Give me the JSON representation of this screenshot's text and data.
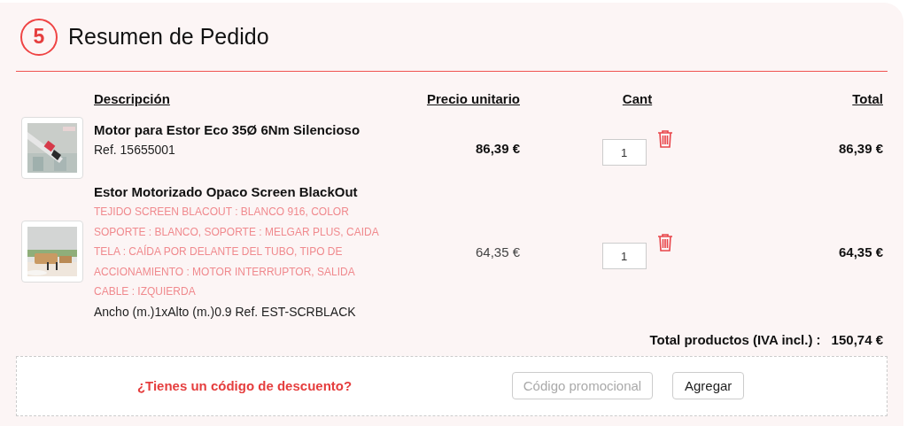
{
  "header": {
    "step": "5",
    "title": "Resumen de Pedido"
  },
  "table": {
    "columns": [
      "Descripción",
      "Precio unitario",
      "Cant",
      "Total"
    ],
    "rows": [
      {
        "name": "Motor para Estor Eco 35Ø 6Nm Silencioso",
        "options": "",
        "ref": "Ref. 15655001",
        "unit_price": "86,39 €",
        "price_emphasized": true,
        "quantity": "1",
        "total": "86,39 €"
      },
      {
        "name": "Estor Motorizado Opaco Screen BlackOut",
        "options": "TEJIDO SCREEN BLACOUT : BLANCO 916, COLOR SOPORTE : BLANCO, SOPORTE : MELGAR PLUS, CAIDA TELA : CAÍDA POR DELANTE DEL TUBO, TIPO DE ACCIONAMIENTO : MOTOR INTERRUPTOR, SALIDA CABLE : IZQUIERDA",
        "ref": "Ancho (m.)1xAlto (m.)0.9 Ref. EST-SCRBLACK",
        "unit_price": "64,35 €",
        "price_emphasized": false,
        "quantity": "1",
        "total": "64,35 €"
      }
    ]
  },
  "summary": {
    "label": "Total productos  (IVA incl.) :",
    "value": "150,74 €"
  },
  "discount": {
    "prompt": "¿Tienes un código de descuento?",
    "placeholder": "Código promocional",
    "button": "Agregar"
  }
}
